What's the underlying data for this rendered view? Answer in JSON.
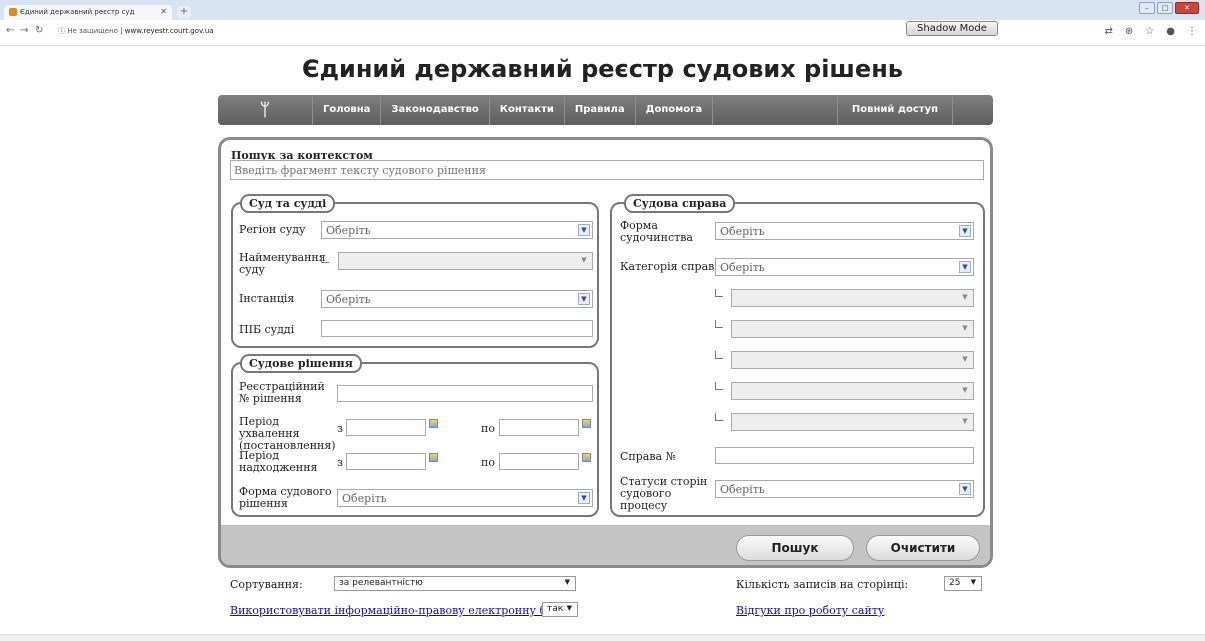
{
  "browser": {
    "tab_title": "Єдиний державний реєстр суд",
    "address_warning": "ⓘ Не защищено",
    "address_url": "www.reyestr.court.gov.ua",
    "shadow_mode_label": "Shadow Mode"
  },
  "page": {
    "title": "Єдиний державний реєстр судових рішень"
  },
  "nav": {
    "emblem": "ᛘ",
    "items": [
      "Головна",
      "Законодавство",
      "Контакти",
      "Правила",
      "Допомога"
    ],
    "full_access": "Повний доступ"
  },
  "context_search": {
    "label": "Пошук за контекстом",
    "placeholder": "Введіть фрагмент тексту судового рішення"
  },
  "court_section": {
    "legend": "Суд та судді",
    "region_label": "Регіон суду",
    "region_value": "Оберіть",
    "court_name_label": "Найменування суду",
    "instance_label": "Інстанція",
    "instance_value": "Оберіть",
    "judge_label": "ПІБ судді"
  },
  "decision_section": {
    "legend": "Судове рішення",
    "reg_no_label": "Реєстраційний № рішення",
    "adoption_period_label": "Період ухвалення (постановлення)",
    "receipt_period_label": "Період надходження",
    "from_label": "з",
    "to_label": "по",
    "form_label": "Форма судового рішення",
    "form_value": "Оберіть"
  },
  "case_section": {
    "legend": "Судова справа",
    "proceeding_form_label": "Форма судочинства",
    "proceeding_form_value": "Оберіть",
    "category_label": "Категорія справи",
    "category_value": "Оберіть",
    "case_no_label": "Справа №",
    "party_status_label": "Статуси сторін судового процесу",
    "party_status_value": "Оберіть"
  },
  "buttons": {
    "search": "Пошук",
    "clear": "Очистити"
  },
  "below": {
    "sort_label": "Сортування:",
    "sort_value": "за релевантністю",
    "per_page_label": "Кількість записів на сторінці:",
    "per_page_value": "25",
    "use_base_link": "Використовувати інформаційно-правову електронну базу:",
    "use_base_value": "так",
    "feedback_link": "Відгуки про роботу сайту"
  }
}
